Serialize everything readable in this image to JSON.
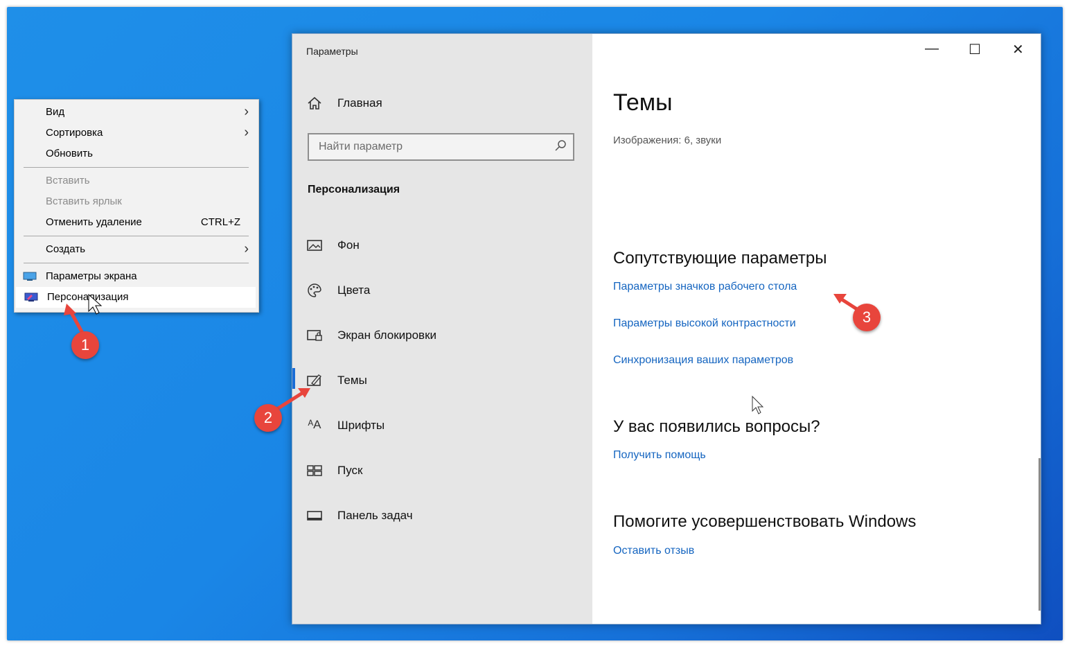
{
  "context_menu": {
    "items": [
      {
        "label": "Вид",
        "submenu": true,
        "disabled": false
      },
      {
        "label": "Сортировка",
        "submenu": true,
        "disabled": false
      },
      {
        "label": "Обновить",
        "disabled": false
      },
      {
        "label": "Вставить",
        "disabled": true
      },
      {
        "label": "Вставить ярлык",
        "disabled": true
      },
      {
        "label": "Отменить удаление",
        "shortcut": "CTRL+Z",
        "disabled": false
      },
      {
        "label": "Создать",
        "submenu": true,
        "disabled": false
      },
      {
        "label": "Параметры экрана",
        "icon": "display-icon",
        "disabled": false
      },
      {
        "label": "Персонализация",
        "icon": "personalize-icon",
        "disabled": false,
        "highlighted": true
      }
    ]
  },
  "window": {
    "title": "Параметры",
    "controls": {
      "minimize": "—",
      "maximize": "☐",
      "close": "✕"
    }
  },
  "nav": {
    "home": {
      "label": "Главная",
      "icon": "home-icon"
    },
    "search_placeholder": "Найти параметр",
    "section_title": "Персонализация",
    "items": [
      {
        "label": "Фон",
        "icon": "picture-icon"
      },
      {
        "label": "Цвета",
        "icon": "palette-icon"
      },
      {
        "label": "Экран блокировки",
        "icon": "lock-screen-icon"
      },
      {
        "label": "Темы",
        "icon": "themes-icon",
        "active": true
      },
      {
        "label": "Шрифты",
        "icon": "fonts-icon"
      },
      {
        "label": "Пуск",
        "icon": "start-icon"
      },
      {
        "label": "Панель задач",
        "icon": "taskbar-icon"
      }
    ]
  },
  "content": {
    "title": "Темы",
    "subtitle": "Изображения: 6, звуки",
    "related_title": "Сопутствующие параметры",
    "related_links": [
      "Параметры значков рабочего стола",
      "Параметры высокой контрастности",
      "Синхронизация ваших параметров"
    ],
    "questions_title": "У вас появились вопросы?",
    "questions_link": "Получить помощь",
    "improve_title": "Помогите усовершенствовать Windows",
    "improve_link": "Оставить отзыв"
  },
  "callouts": [
    "1",
    "2",
    "3"
  ],
  "colors": {
    "desktop": "#1a86e6",
    "link": "#1565c0",
    "badge": "#e8453c",
    "nav_bg": "#e6e6e6"
  }
}
